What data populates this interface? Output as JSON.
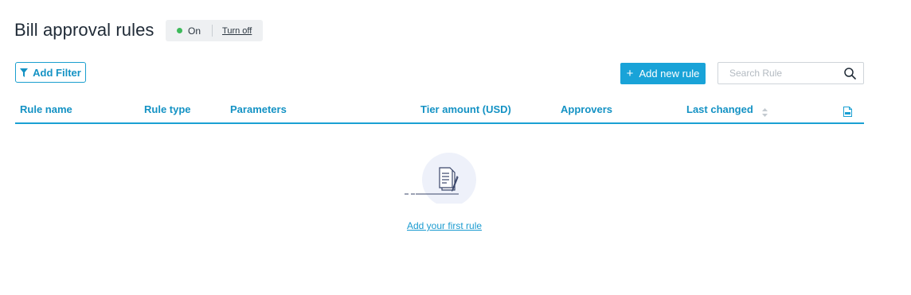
{
  "page": {
    "title": "Bill approval rules"
  },
  "status": {
    "label": "On",
    "toggle_label": "Turn off",
    "dot_color": "#3dba5a"
  },
  "toolbar": {
    "add_filter_label": "Add Filter",
    "add_rule_label": "Add new rule",
    "search_placeholder": "Search Rule"
  },
  "table": {
    "columns": [
      "Rule name",
      "Rule type",
      "Parameters",
      "Tier amount (USD)",
      "Approvers",
      "Last changed"
    ]
  },
  "empty_state": {
    "link_label": "Add your first rule"
  },
  "icons": [
    "filter-icon",
    "plus-icon",
    "search-icon",
    "sort-icon",
    "csv-export-icon",
    "document-edit-icon"
  ],
  "colors": {
    "accent": "#1aa0d3",
    "button_bg": "#19a3d8",
    "chip_bg": "#eef0f2"
  }
}
